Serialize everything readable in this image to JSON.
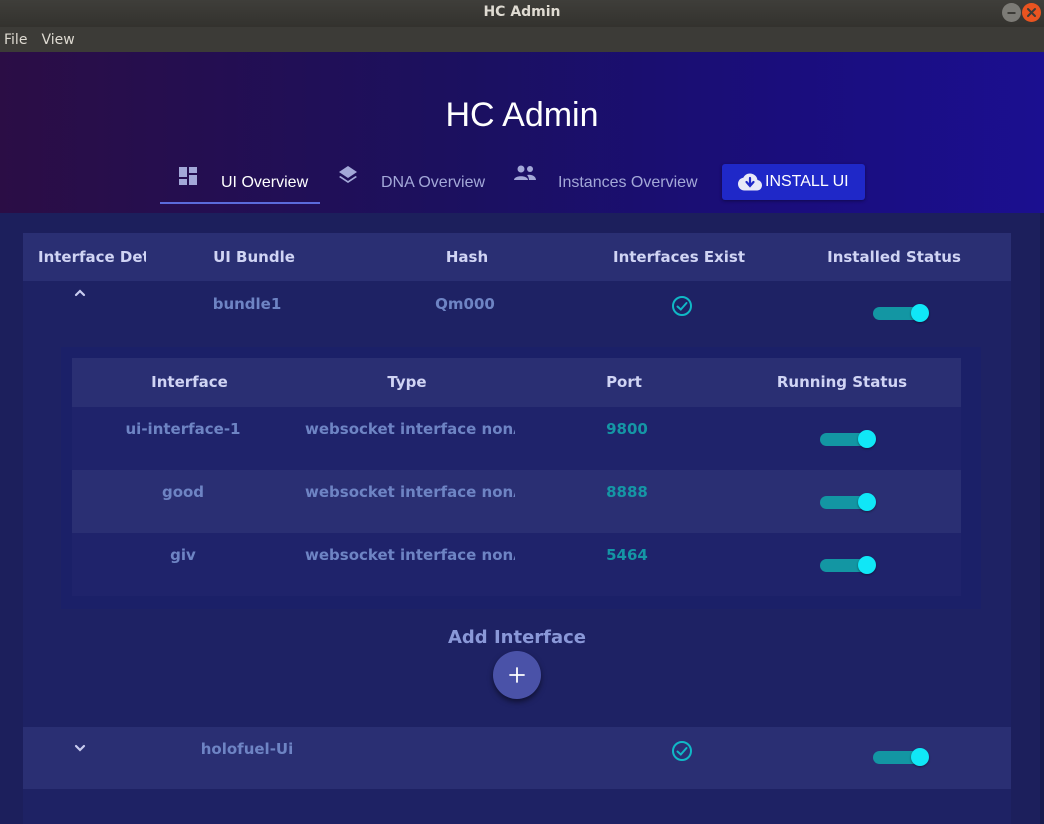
{
  "window": {
    "title": "HC Admin"
  },
  "menubar": {
    "items": [
      "File",
      "View"
    ]
  },
  "header": {
    "title": "HC Admin",
    "tabs": [
      {
        "label": "UI Overview",
        "icon": "dashboard-icon",
        "active": true
      },
      {
        "label": "DNA Overview",
        "icon": "layers-icon",
        "active": false
      },
      {
        "label": "Instances Overview",
        "icon": "people-icon",
        "active": false
      }
    ],
    "install_label": "INSTALL UI"
  },
  "table": {
    "headers": [
      "Interface Details",
      "UI Bundle",
      "Hash",
      "Interfaces Exist",
      "Installed Status"
    ],
    "rows": [
      {
        "bundle": "bundle1",
        "hash": "Qm000",
        "expanded": true,
        "interfaces_exist": true,
        "installed": true
      },
      {
        "bundle": "holofuel-Ui",
        "hash": "",
        "expanded": false,
        "interfaces_exist": true,
        "installed": true
      }
    ]
  },
  "interfaces": {
    "headers": [
      "Interface",
      "Type",
      "Port",
      "Running Status"
    ],
    "rows": [
      {
        "name": "ui-interface-1",
        "type": "websocket interface nonAdmin",
        "port": "9800",
        "running": true
      },
      {
        "name": "good",
        "type": "websocket interface nonAdmin",
        "port": "8888",
        "running": true
      },
      {
        "name": "giv",
        "type": "websocket interface nonAdmin",
        "port": "5464",
        "running": true
      }
    ],
    "add_label": "Add Interface"
  },
  "colors": {
    "accent": "#1f28c8",
    "toggle_on_track": "#1396a3",
    "toggle_on_thumb": "#10e7f7",
    "check": "#10b8c6"
  }
}
